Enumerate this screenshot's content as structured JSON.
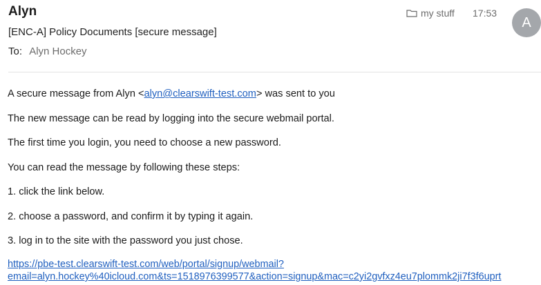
{
  "header": {
    "sender": "Alyn",
    "subject": "[ENC-A] Policy Documents [secure message]",
    "to_label": "To:",
    "to_value": "Alyn Hockey",
    "folder_label": "my stuff",
    "time": "17:53",
    "avatar_initial": "A"
  },
  "body": {
    "line1_prefix": "A secure message from Alyn <",
    "line1_email": "alyn@clearswift-test.com",
    "line1_suffix": "> was sent to you",
    "line2": "The new message can be read by logging into the secure webmail portal.",
    "line3": "The first time you login, you need to choose a new password.",
    "line4": "You can read the message by following these steps:",
    "step1": "1. click the link below.",
    "step2": "2. choose a password, and confirm it by typing it again.",
    "step3": "3. log in to the site with the password you just chose.",
    "link_line1": "https://pbe-test.clearswift-test.com/web/portal/signup/webmail?",
    "link_line2": "email=alyn.hockey%40icloud.com&ts=1518976399577&action=signup&mac=c2yi2gvfxz4eu7plommk2ji7f3f6uprt"
  }
}
